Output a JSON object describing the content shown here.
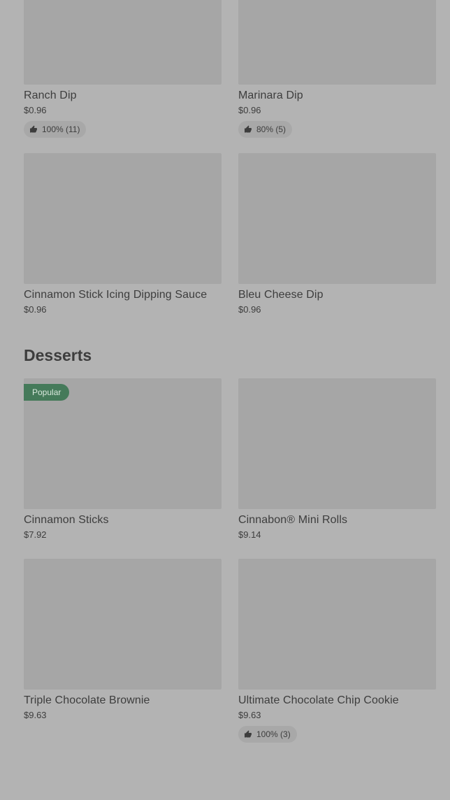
{
  "items_top": [
    {
      "name": "Ranch Dip",
      "price": "$0.96",
      "rating": "100% (11)"
    },
    {
      "name": "Marinara Dip",
      "price": "$0.96",
      "rating": "80% (5)"
    },
    {
      "name": "Cinnamon Stick Icing Dipping Sauce",
      "price": "$0.96"
    },
    {
      "name": "Bleu Cheese Dip",
      "price": "$0.96"
    }
  ],
  "desserts": {
    "title": "Desserts",
    "items": [
      {
        "name": "Cinnamon Sticks",
        "price": "$7.92",
        "badge": "Popular"
      },
      {
        "name": "Cinnabon® Mini Rolls",
        "price": "$9.14"
      },
      {
        "name": "Triple Chocolate Brownie",
        "price": "$9.63"
      },
      {
        "name": "Ultimate Chocolate Chip Cookie",
        "price": "$9.63",
        "rating": "100% (3)"
      }
    ]
  },
  "icons": {
    "rating": "thumbs-up-icon"
  },
  "colors": {
    "badge": "#457a5a",
    "overlay_bg": "#b3b3b3",
    "image_placeholder": "#a6a6a6"
  }
}
